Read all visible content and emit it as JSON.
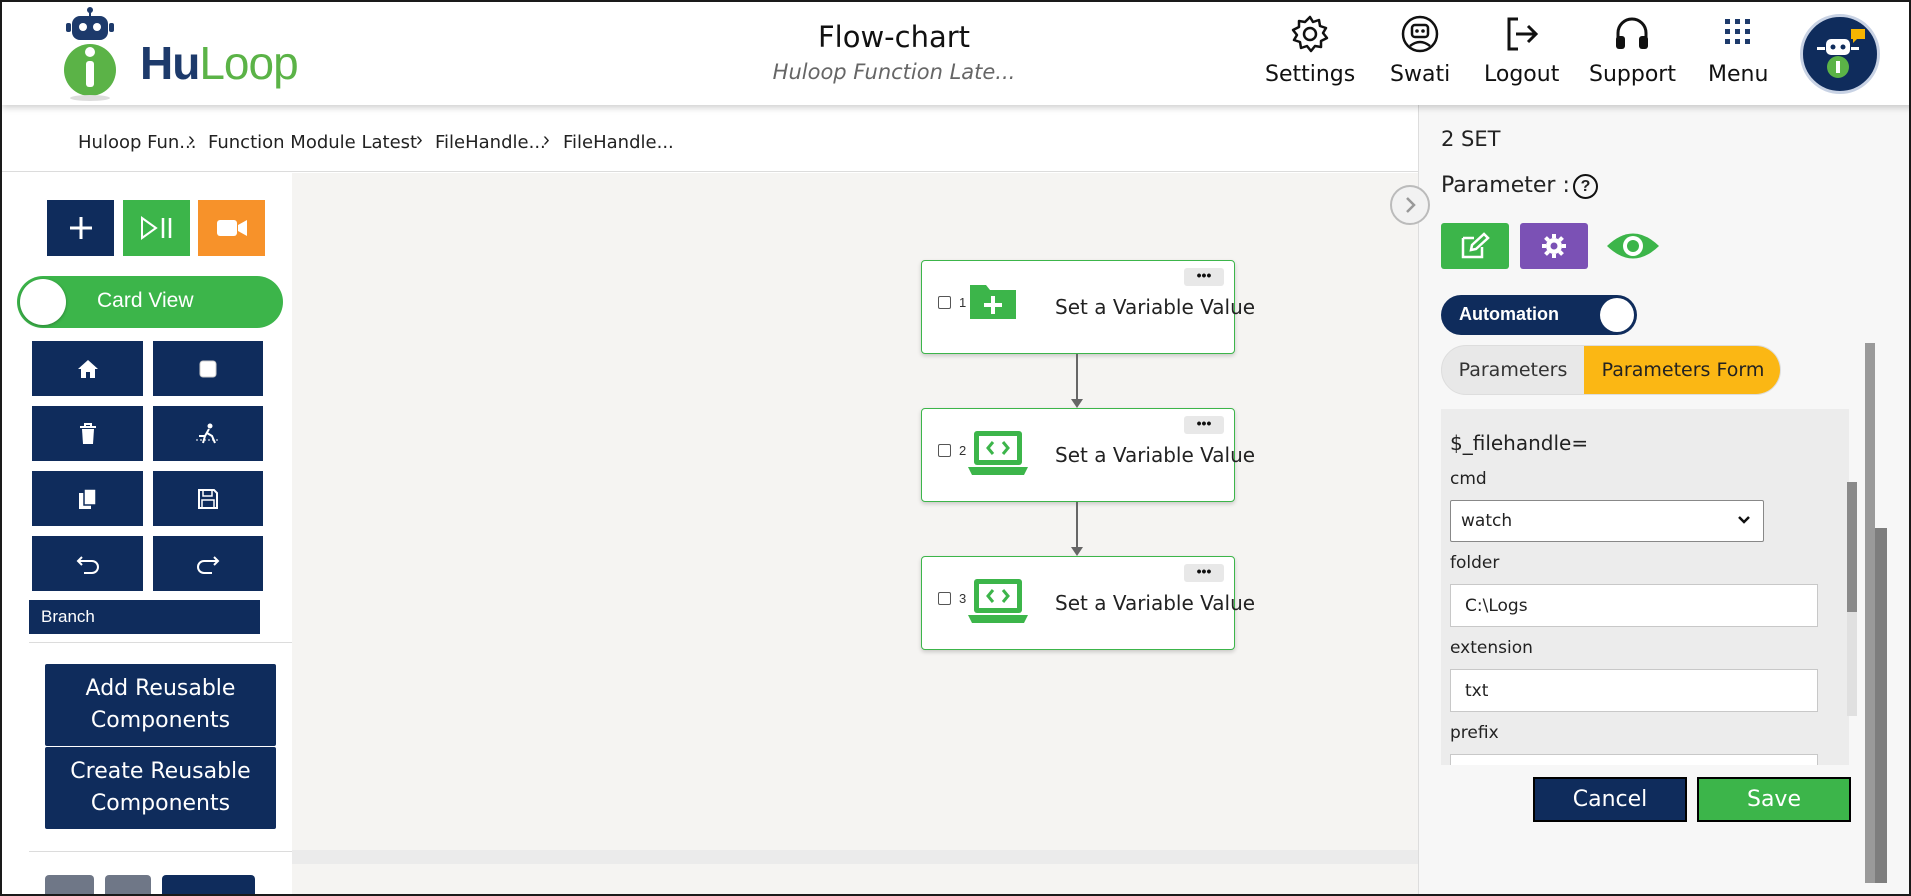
{
  "header": {
    "logo": {
      "hu": "Hu",
      "loop": "Loop"
    },
    "title": "Flow-chart",
    "subtitle": "Huloop Function Late...",
    "nav": [
      {
        "label": "Settings",
        "icon": "gear-icon"
      },
      {
        "label": "Swati",
        "icon": "user-robot-icon"
      },
      {
        "label": "Logout",
        "icon": "logout-icon"
      },
      {
        "label": "Support",
        "icon": "headset-icon"
      },
      {
        "label": "Menu",
        "icon": "grid-icon"
      }
    ]
  },
  "breadcrumb": [
    "Huloop Fun...",
    "Function Module Latest",
    "FileHandle...",
    "FileHandle..."
  ],
  "left_panel": {
    "card_view_label": "Card View",
    "branch_label": "Branch",
    "add_reusable": "Add Reusable Components",
    "create_reusable": "Create Reusable Components"
  },
  "nodes": [
    {
      "number": "1",
      "text": "Set a Variable Value",
      "icon": "folder-add-icon",
      "more": "•••"
    },
    {
      "number": "2",
      "text": "Set a Variable Value",
      "icon": "laptop-code-icon",
      "more": "•••"
    },
    {
      "number": "3",
      "text": "Set a Variable Value",
      "icon": "laptop-code-icon",
      "more": "•••"
    }
  ],
  "right_panel": {
    "set_title": "2 SET",
    "parameter_label": "Parameter :",
    "help": "?",
    "automation_label": "Automation",
    "tabs": {
      "parameters": "Parameters",
      "parameters_form": "Parameters Form"
    },
    "form": {
      "heading": "$_filehandle=",
      "cmd_label": "cmd",
      "cmd_value": "watch",
      "folder_label": "folder",
      "folder_value": "C:\\Logs",
      "extension_label": "extension",
      "extension_value": "txt",
      "prefix_label": "prefix"
    },
    "cancel_label": "Cancel",
    "save_label": "Save"
  },
  "colors": {
    "navy": "#0f2c5c",
    "green": "#3cb54a",
    "orange": "#f7922a",
    "purple": "#7b51b5",
    "tab_active": "#fbb714"
  }
}
